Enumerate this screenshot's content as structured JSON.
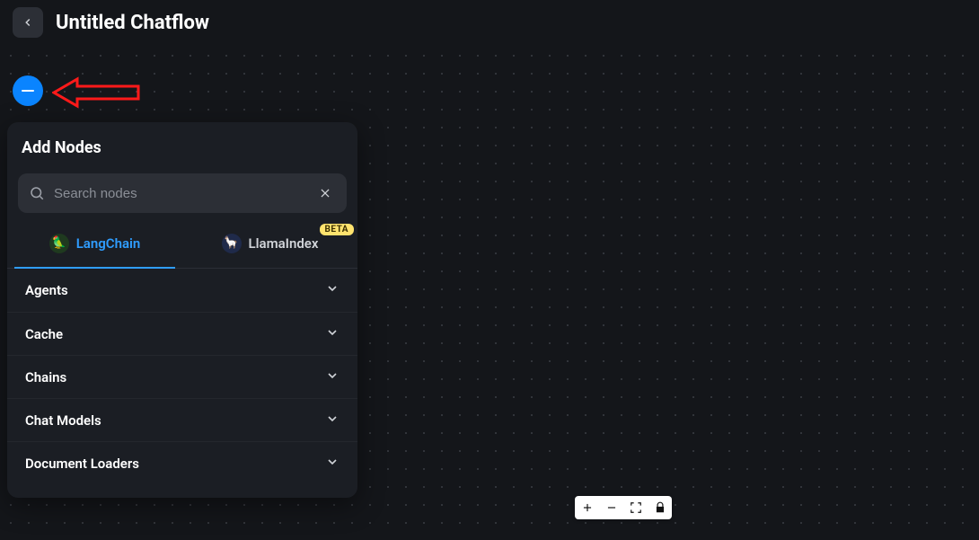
{
  "header": {
    "title": "Untitled Chatflow"
  },
  "fab": {
    "icon": "minus"
  },
  "panel": {
    "title": "Add Nodes",
    "search": {
      "placeholder": "Search nodes",
      "value": ""
    },
    "tabs": [
      {
        "label": "LangChain",
        "active": true,
        "icon": "parrot"
      },
      {
        "label": "LlamaIndex",
        "active": false,
        "icon": "llama",
        "badge": "BETA"
      }
    ],
    "categories": [
      {
        "label": "Agents"
      },
      {
        "label": "Cache"
      },
      {
        "label": "Chains"
      },
      {
        "label": "Chat Models"
      },
      {
        "label": "Document Loaders"
      }
    ]
  },
  "zoom": {
    "buttons": [
      "zoom-in",
      "zoom-out",
      "fit-view",
      "lock"
    ]
  },
  "colors": {
    "accent": "#0a84ff",
    "badge": "#ffe36e"
  }
}
